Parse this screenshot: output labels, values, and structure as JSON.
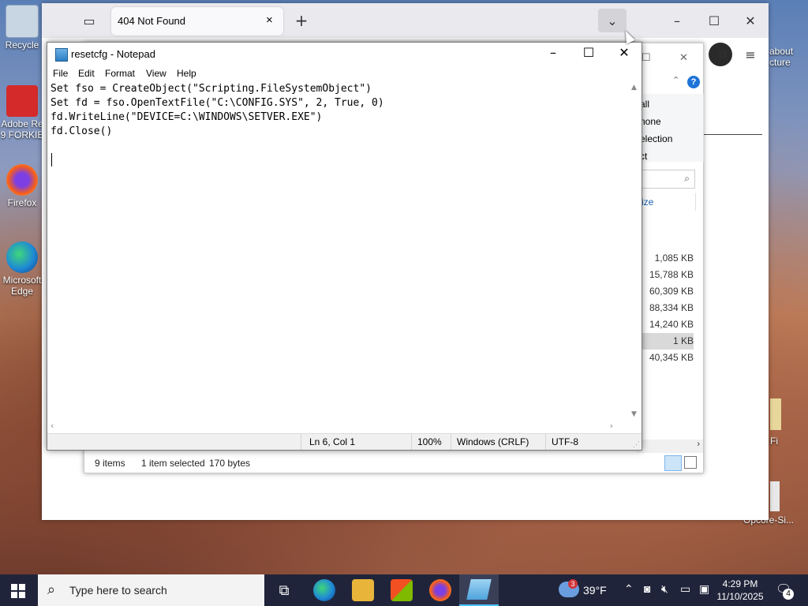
{
  "desktop": {
    "icons": [
      {
        "label": "Recycle",
        "color": "#b8c8d8"
      },
      {
        "label": "Adobe Re 9 FORKIE",
        "color": "#d42a2a"
      },
      {
        "label": "Firefox",
        "color": "#e86b1e"
      },
      {
        "label": "Microsoft Edge",
        "color": "#1f8ad4"
      }
    ],
    "right_labels": {
      "top": "about cture",
      "mid": "Fi",
      "bottom": "Opcore-Si..."
    }
  },
  "browser": {
    "tab_title": "404 Not Found",
    "new_tab_symbol": "+",
    "close_symbol": "×"
  },
  "explorer": {
    "ribbon_items": [
      "all",
      "none",
      "election",
      "ct"
    ],
    "column_header": "ize",
    "sizes": [
      "1,085 KB",
      "15,788 KB",
      "60,309 KB",
      "88,334 KB",
      "14,240 KB",
      "1 KB",
      "40,345 KB"
    ],
    "selected_index": 5,
    "status": {
      "items": "9 items",
      "selected": "1 item selected",
      "bytes": "170 bytes"
    }
  },
  "notepad": {
    "title": "resetcfg - Notepad",
    "menu": [
      "File",
      "Edit",
      "Format",
      "View",
      "Help"
    ],
    "lines": [
      "Set fso = CreateObject(\"Scripting.FileSystemObject\")",
      "Set fd = fso.OpenTextFile(\"C:\\CONFIG.SYS\", 2, True, 0)",
      "fd.WriteLine(\"DEVICE=C:\\WINDOWS\\SETVER.EXE\")",
      "fd.Close()",
      "",
      ""
    ],
    "status": {
      "position": "Ln 6, Col 1",
      "zoom": "100%",
      "line_endings": "Windows (CRLF)",
      "encoding": "UTF-8"
    }
  },
  "taskbar": {
    "search_placeholder": "Type here to search",
    "weather_temp": "39°F",
    "weather_badge": "3",
    "time": "4:29 PM",
    "date": "11/10/2025",
    "notification_count": "4",
    "accent": "#4cc2ff"
  }
}
